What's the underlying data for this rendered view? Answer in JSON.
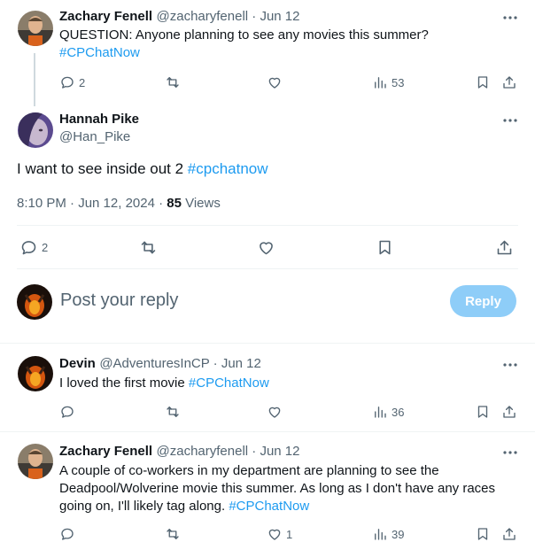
{
  "colors": {
    "accent": "#1d9bf0",
    "muted": "#536471",
    "reply_button": "#8ecdf8"
  },
  "parent_tweet": {
    "name": "Zachary Fenell",
    "handle_date": "@zacharyfenell · Jun 12",
    "text": "QUESTION: Anyone planning to see any movies this summer?",
    "hashtag": "#CPChatNow",
    "replies": "2",
    "views": "53"
  },
  "main_tweet": {
    "name": "Hannah Pike",
    "handle": "@Han_Pike",
    "text": "I want to see inside out 2",
    "hashtag": "#cpchatnow",
    "timestamp": "8:10 PM · Jun 12, 2024 · ",
    "views_count": "85",
    "views_label": " Views",
    "replies": "2"
  },
  "reply_box": {
    "placeholder": "Post your reply",
    "button_label": "Reply"
  },
  "reply_1": {
    "name": "Devin",
    "handle_date": "@AdventuresInCP · Jun 12",
    "text": "I loved the first movie",
    "hashtag": "#CPChatNow",
    "views": "36"
  },
  "reply_2": {
    "name": "Zachary Fenell",
    "handle_date": "@zacharyfenell · Jun 12",
    "text_line1": "A couple of co-workers in my department are planning to see the",
    "text_line2": "Deadpool/Wolverine movie this summer. As long as I don't have any races",
    "text_line3": "going on, I'll likely tag along.",
    "hashtag": "#CPChatNow",
    "likes": "1",
    "views": "39"
  },
  "icons": [
    "more-icon",
    "reply-icon",
    "retweet-icon",
    "like-icon",
    "views-icon",
    "bookmark-icon",
    "share-icon"
  ]
}
